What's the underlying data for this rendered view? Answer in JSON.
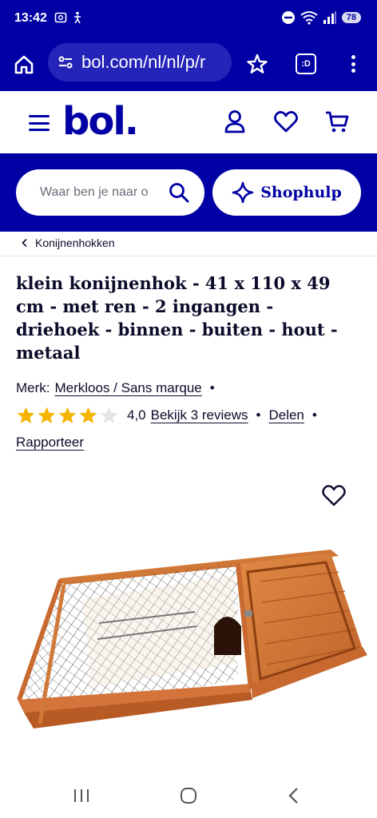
{
  "status_bar": {
    "time": "13:42",
    "battery": "78"
  },
  "browser": {
    "url": "bol.com/nl/nl/p/r",
    "tab_label": ":D"
  },
  "site": {
    "logo": "bol.",
    "search_placeholder": "Waar ben je naar o",
    "shophulp_label": "Shophulp",
    "brand_color": "#0000a4"
  },
  "breadcrumb": {
    "label": "Konijnenhokken"
  },
  "product": {
    "title": "klein konijnenhok - 41 x 110 x 49 cm - met ren - 2 ingangen - driehoek - binnen - buiten - hout - metaal",
    "brand_prefix": "Merk:",
    "brand": "Merkloos / Sans marque",
    "rating": "4,0",
    "rating_value": 4,
    "rating_max": 5,
    "reviews_link": "Bekijk 3 reviews",
    "share_link": "Delen",
    "report_link": "Rapporteer",
    "star_color": "#f5b400"
  },
  "icons": {
    "home": "home-icon",
    "url_settings": "tune-icon",
    "bookmark": "star-outline-icon",
    "menu": "more-vert-icon",
    "hamburger": "hamburger-icon",
    "account": "user-icon",
    "wishlist": "heart-icon",
    "cart": "cart-icon",
    "search": "search-icon",
    "sparkle": "sparkle-icon"
  }
}
